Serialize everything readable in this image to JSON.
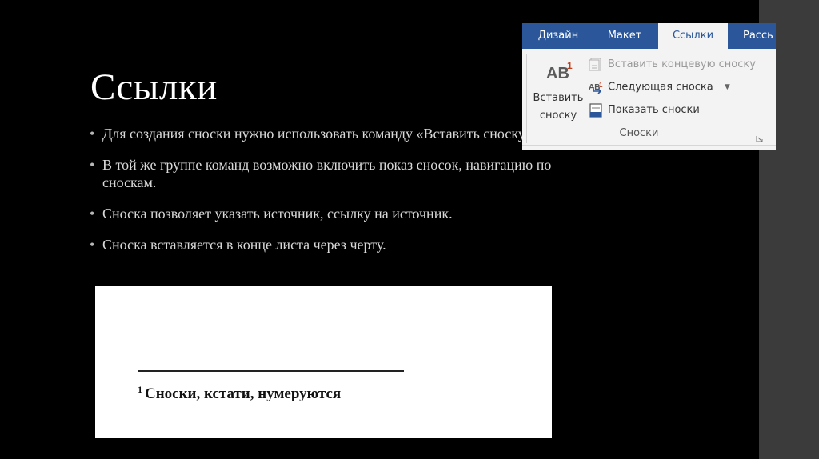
{
  "slide": {
    "title": "Ссылки",
    "bullets": [
      "Для создания сноски нужно использовать команду «Вставить сноску».",
      "В той же группе команд возможно включить показ сносок, навигацию по сноскам.",
      "Сноска позволяет указать источник, ссылку на источник.",
      "Сноска вставляется в конце листа через черту."
    ]
  },
  "ribbon": {
    "tabs": [
      "Дизайн",
      "Макет",
      "Ссылки",
      "Рассь"
    ],
    "active_tab": "Ссылки",
    "insert_footnote": {
      "icon_text": "AB",
      "icon_superscript": "1",
      "label_line1": "Вставить",
      "label_line2": "сноску"
    },
    "commands": {
      "insert_endnote": "Вставить концевую сноску",
      "next_footnote": "Следующая сноска",
      "show_notes": "Показать сноски",
      "next_footnote_icon_text": "AB",
      "next_footnote_icon_sup": "1"
    },
    "group_label": "Сноски",
    "colors": {
      "tab_bar": "#2b579a",
      "ribbon_bg": "#f3f3f3",
      "superscript_accent": "#c43e1c"
    }
  },
  "footnote_example": {
    "number": "1",
    "text": "Сноски, кстати, нумеруются"
  }
}
